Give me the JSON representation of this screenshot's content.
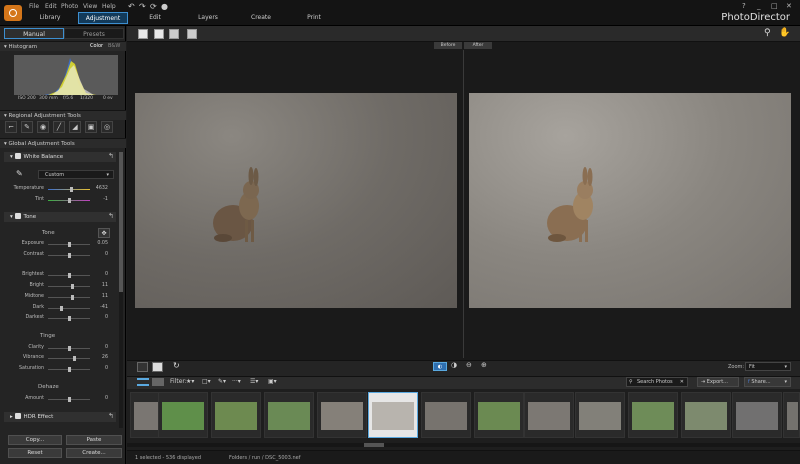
{
  "menu": [
    "File",
    "Edit",
    "Photo",
    "View",
    "Help"
  ],
  "modes": [
    "Library",
    "Adjustment",
    "Edit",
    "Layers",
    "Create",
    "Print"
  ],
  "brand": "PhotoDirector",
  "window_controls": [
    "_",
    "□",
    "✕"
  ],
  "left_tabs": {
    "manual": "Manual",
    "presets": "Presets"
  },
  "histogram": {
    "title": "Histogram",
    "color_label": "Color",
    "bw_label": "B&W",
    "info": [
      "ISO 200",
      "300 mm",
      "f/5.6",
      "1/320",
      "0 ev"
    ]
  },
  "regional": {
    "title": "Regional Adjustment Tools"
  },
  "global": {
    "title": "Global Adjustment Tools"
  },
  "white_balance": {
    "title": "White Balance",
    "preset": "Custom",
    "temperature_label": "Temperature",
    "temperature_value": "4632",
    "temperature_pos": 0.55,
    "tint_label": "Tint",
    "tint_value": "-1",
    "tint_pos": 0.49
  },
  "tone": {
    "title": "Tone",
    "subtitle": "Tone",
    "sliders": [
      {
        "label": "Exposure",
        "value": "0.05",
        "pos": 0.51
      },
      {
        "label": "Contrast",
        "value": "0",
        "pos": 0.5
      },
      {
        "label": "Brightest",
        "value": "0",
        "pos": 0.5
      },
      {
        "label": "Bright",
        "value": "11",
        "pos": 0.56
      },
      {
        "label": "Midtone",
        "value": "11",
        "pos": 0.56
      },
      {
        "label": "Dark",
        "value": "-41",
        "pos": 0.3
      },
      {
        "label": "Darkest",
        "value": "0",
        "pos": 0.5
      }
    ]
  },
  "tinge": {
    "title": "Tinge",
    "sliders": [
      {
        "label": "Clarity",
        "value": "0",
        "pos": 0.5
      },
      {
        "label": "Vibrance",
        "value": "26",
        "pos": 0.63
      },
      {
        "label": "Saturation",
        "value": "0",
        "pos": 0.5
      }
    ]
  },
  "dehaze": {
    "title": "Dehaze",
    "slider": {
      "label": "Amount",
      "value": "0",
      "pos": 0.5
    }
  },
  "hdr": {
    "title": "HDR Effect"
  },
  "buttons": {
    "copy": "Copy...",
    "paste": "Paste",
    "reset": "Reset",
    "create": "Create..."
  },
  "compare": {
    "before": "Before",
    "after": "After"
  },
  "zoom": {
    "label": "Zoom:",
    "value": "Fit"
  },
  "filter": {
    "label": "Filter:"
  },
  "search": {
    "placeholder": "Search Photos"
  },
  "export": {
    "label": "Export..."
  },
  "share": {
    "label": "Share..."
  },
  "status": {
    "selection": "1 selected - 536 displayed",
    "path": "Folders / run / DSC_5003.nef"
  }
}
